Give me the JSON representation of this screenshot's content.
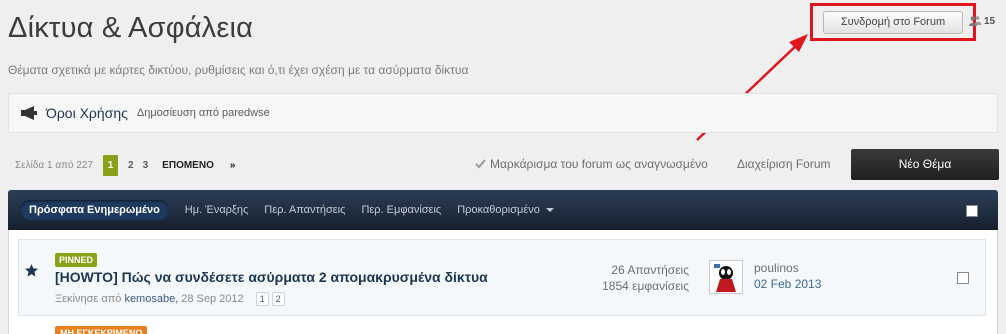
{
  "header": {
    "title": "Δίκτυα & Ασφάλεια",
    "description": "Θέματα σχετικά με κάρτες δικτύου, ρυθμίσεις και ό,τι έχει σχέση με τα ασύρματα δίκτυα",
    "follow_label": "Συνδρομή στο Forum",
    "followers_count": "15"
  },
  "announcement": {
    "title": "Όροι Χρήσης",
    "posted_by": "Δημοσίευση από paredwse"
  },
  "pagination": {
    "page_of": "Σελίδα 1 από 227",
    "current": "1",
    "pages": [
      "2",
      "3"
    ],
    "next_label": "ΕΠΟΜΕΝΟ",
    "last_label": "»"
  },
  "actions": {
    "mark_read": "Μαρκάρισμα του forum ως αναγνωσμένο",
    "manage": "Διαχείριση Forum",
    "new_topic": "Νέο Θέμα"
  },
  "filters": {
    "active": "Πρόσφατα Ενημερωμένο",
    "tabs": [
      "Ημ. Έναρξης",
      "Περ. Απαντήσεις",
      "Περ. Εμφανίσεις",
      "Προκαθορισμένο"
    ]
  },
  "topics": [
    {
      "badge": "PINNED",
      "title": "[HOWTO] Πώς να συνδέσετε ασύρματα 2 απομακρυσμένα δίκτυα",
      "started_prefix": "Ξεκίνησε από",
      "author": "kemosabe,",
      "date": "28 Sep 2012",
      "mini_pages": [
        "1",
        "2"
      ],
      "replies": "26 Απαντήσεις",
      "views": "1854 εμφανίσεις",
      "last_poster": "poulinos",
      "last_date": "02 Feb 2013"
    }
  ],
  "next_badge": "ΜΗ ΕΓΚΕΚΡΙΜΕΝΟ",
  "colors": {
    "accent_green": "#8aa019",
    "link_blue": "#1d3652",
    "annotation_red": "#e0161e",
    "badge_orange": "#e8801d"
  }
}
